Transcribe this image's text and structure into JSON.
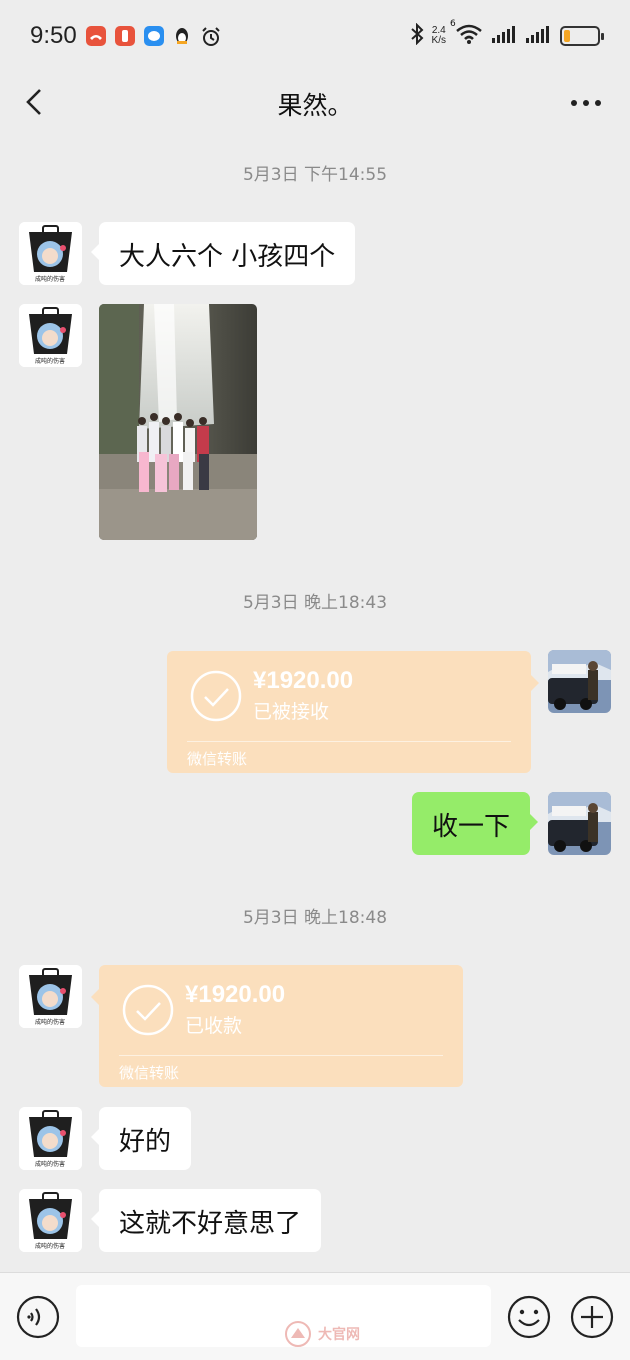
{
  "status_bar": {
    "time": "9:50",
    "network_speed": "2.4",
    "network_unit": "K/s",
    "wifi_badge": "6",
    "battery_level": 0.2,
    "app_icons": [
      "missed-call-icon",
      "red-app-icon",
      "blue-chat-icon",
      "qq-penguin-icon",
      "alarm-icon"
    ]
  },
  "header": {
    "title": "果然。"
  },
  "messages": {
    "ts1": "5月3日 下午14:55",
    "m1_text": "大人六个 小孩四个",
    "ts2": "5月3日 晚上18:43",
    "t1_amount": "¥1920.00",
    "t1_status": "已被接收",
    "t1_footer": "微信转账",
    "m3_text": "收一下",
    "ts3": "5月3日 晚上18:48",
    "t2_amount": "¥1920.00",
    "t2_status": "已收款",
    "t2_footer": "微信转账",
    "m5_text": "好的",
    "m6_text": "这就不好意思了"
  },
  "avatar_caption": "成吨的伤害",
  "input_bar": {
    "message_value": "",
    "watermark": "大官网"
  },
  "colors": {
    "background": "#ededed",
    "self_bubble": "#95ec69",
    "transfer_card": "#fbdfbd"
  }
}
